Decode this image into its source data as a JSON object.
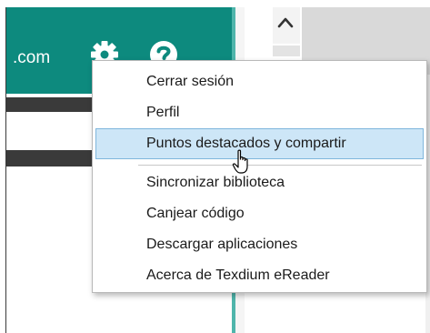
{
  "header": {
    "domain_suffix": ".com",
    "settings_icon": "gear-icon",
    "help_icon": "question-circle-icon",
    "color": "#0d8a7e"
  },
  "menu": {
    "items": [
      {
        "label": "Cerrar sesión",
        "highlighted": false
      },
      {
        "label": "Perfil",
        "highlighted": false
      },
      {
        "label": "Puntos destacados y compartir",
        "highlighted": true
      },
      {
        "label": "Sincronizar biblioteca",
        "highlighted": false
      },
      {
        "label": "Canjear código",
        "highlighted": false
      },
      {
        "label": "Descargar aplicaciones",
        "highlighted": false
      },
      {
        "label": "Acerca de Texdium eReader",
        "highlighted": false
      }
    ],
    "highlight_color": "#cde6f7"
  },
  "scrollbar": {
    "up_icon": "chevron-up-icon"
  },
  "cursor": {
    "icon": "hand-pointer-icon"
  }
}
